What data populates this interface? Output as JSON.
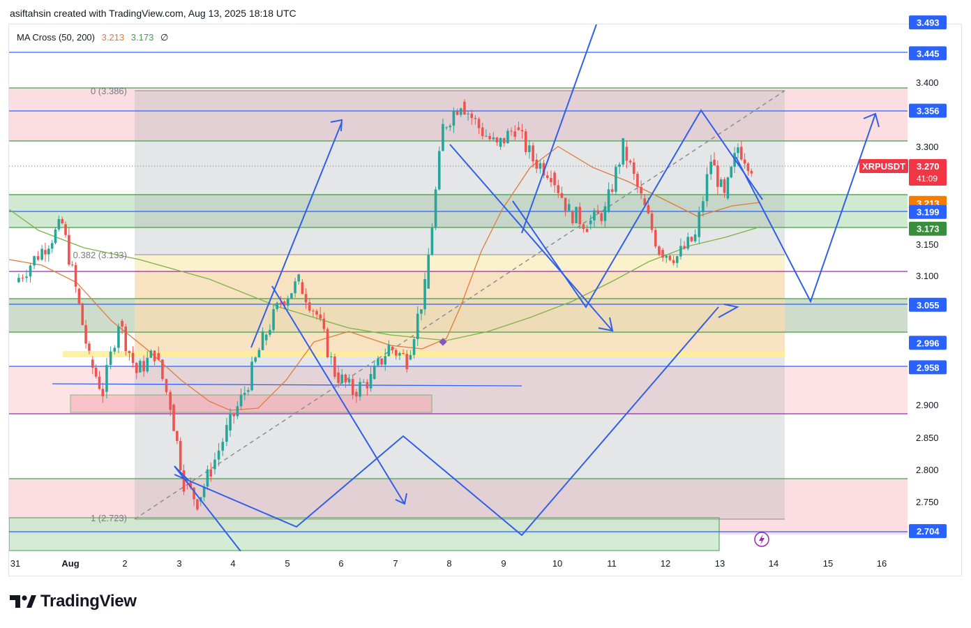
{
  "header": {
    "text": "asiftahsin created with TradingView.com, Aug 13, 2025 18:18 UTC"
  },
  "indicator": {
    "name": "MA Cross (50, 200)",
    "fast_value": "3.213",
    "slow_value": "3.173",
    "icon": "∅",
    "fast_color": "#e07b39",
    "slow_color": "#43a047"
  },
  "symbol": {
    "ticker": "XRPUSDT",
    "price": "3.270",
    "countdown": "41:09",
    "color": "#f23645"
  },
  "price_axis": {
    "ticks": [
      "3.400",
      "3.300",
      "3.150",
      "3.100",
      "2.900",
      "2.850",
      "2.800",
      "2.750"
    ],
    "level_badges": [
      {
        "label": "3.493",
        "color": "#2962ff"
      },
      {
        "label": "3.445",
        "color": "#2962ff"
      },
      {
        "label": "3.356",
        "color": "#2962ff"
      },
      {
        "label": "3.213",
        "color": "#f57c00"
      },
      {
        "label": "3.199",
        "color": "#2962ff"
      },
      {
        "label": "3.173",
        "color": "#388e3c"
      },
      {
        "label": "3.055",
        "color": "#2962ff"
      },
      {
        "label": "2.996",
        "color": "#2962ff"
      },
      {
        "label": "2.958",
        "color": "#2962ff"
      },
      {
        "label": "2.704",
        "color": "#2962ff"
      }
    ]
  },
  "time_axis": {
    "ticks": [
      "31",
      "Aug",
      "2",
      "3",
      "4",
      "5",
      "6",
      "7",
      "8",
      "9",
      "10",
      "11",
      "12",
      "13",
      "14",
      "15",
      "16"
    ]
  },
  "fib": {
    "level_0": "0 (3.386)",
    "level_0382": "0.382 (3.133)",
    "level_1": "1 (2.723)"
  },
  "chart_data": {
    "type": "candlestick",
    "symbol": "XRPUSDT",
    "last_price": 3.27,
    "ylim": [
      2.68,
      3.53
    ],
    "x_range": [
      "Jul 31",
      "Aug 16"
    ],
    "ma_fast": {
      "name": "MA Cross (50, 200)",
      "value": 3.213
    },
    "ma_slow": {
      "value": 3.173
    },
    "horizontal_levels": [
      3.493,
      3.445,
      3.386,
      3.356,
      3.311,
      3.213,
      3.199,
      3.173,
      3.133,
      3.106,
      3.055,
      2.996,
      2.958,
      2.888,
      2.786,
      2.723,
      2.704
    ],
    "fibonacci": [
      {
        "ratio": 0,
        "price": 3.386
      },
      {
        "ratio": 0.382,
        "price": 3.133
      },
      {
        "ratio": 1,
        "price": 2.723
      }
    ],
    "price_path": [
      [
        "Jul 31",
        3.09
      ],
      [
        "Jul 31",
        3.14
      ],
      [
        "Aug 1",
        3.18
      ],
      [
        "Aug 1",
        3.08
      ],
      [
        "Aug 1",
        2.97
      ],
      [
        "Aug 1",
        2.92
      ],
      [
        "Aug 2",
        3.03
      ],
      [
        "Aug 2",
        2.95
      ],
      [
        "Aug 2",
        2.98
      ],
      [
        "Aug 3",
        2.9
      ],
      [
        "Aug 3",
        2.78
      ],
      [
        "Aug 3",
        2.75
      ],
      [
        "Aug 3",
        2.8
      ],
      [
        "Aug 4",
        2.86
      ],
      [
        "Aug 4",
        2.92
      ],
      [
        "Aug 4",
        3.0
      ],
      [
        "Aug 5",
        3.06
      ],
      [
        "Aug 5",
        3.09
      ],
      [
        "Aug 5",
        3.04
      ],
      [
        "Aug 6",
        2.95
      ],
      [
        "Aug 6",
        2.92
      ],
      [
        "Aug 6",
        2.94
      ],
      [
        "Aug 7",
        2.99
      ],
      [
        "Aug 7",
        2.97
      ],
      [
        "Aug 7",
        3.08
      ],
      [
        "Aug 8",
        3.33
      ],
      [
        "Aug 8",
        3.37
      ],
      [
        "Aug 8",
        3.33
      ],
      [
        "Aug 9",
        3.3
      ],
      [
        "Aug 9",
        3.33
      ],
      [
        "Aug 9",
        3.28
      ],
      [
        "Aug 10",
        3.26
      ],
      [
        "Aug 10",
        3.2
      ],
      [
        "Aug 10",
        3.18
      ],
      [
        "Aug 11",
        3.2
      ],
      [
        "Aug 11",
        3.3
      ],
      [
        "Aug 11",
        3.22
      ],
      [
        "Aug 12",
        3.14
      ],
      [
        "Aug 12",
        3.13
      ],
      [
        "Aug 12",
        3.16
      ],
      [
        "Aug 13",
        3.28
      ],
      [
        "Aug 13",
        3.22
      ],
      [
        "Aug 13",
        3.3
      ],
      [
        "Aug 13",
        3.27
      ]
    ]
  },
  "brand": {
    "name": "TradingView"
  }
}
